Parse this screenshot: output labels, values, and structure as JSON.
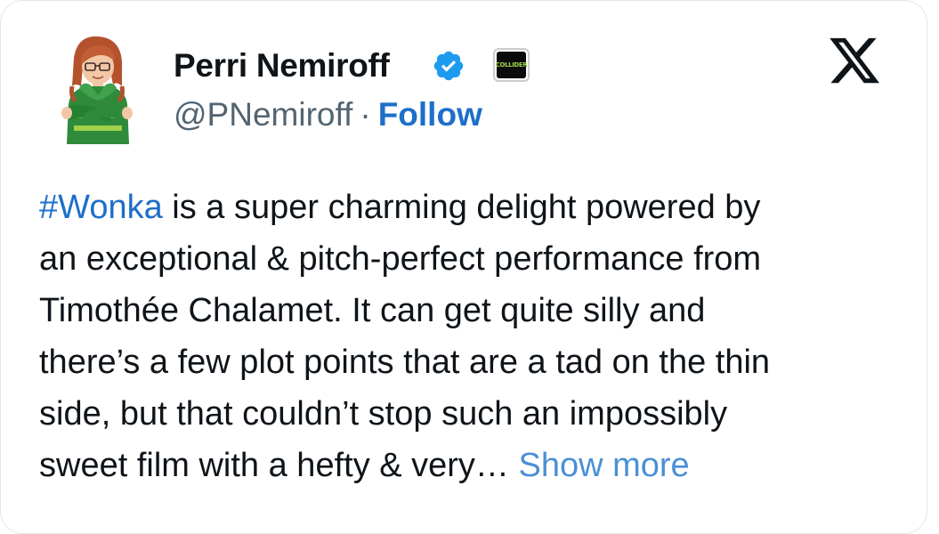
{
  "author": {
    "display_name": "Perri Nemiroff",
    "handle": "@PNemiroff",
    "separator": "·",
    "follow_label": "Follow",
    "verified": true,
    "affiliate_badge_text": "COLLIDER"
  },
  "platform": {
    "logo_icon": "x-logo-icon"
  },
  "tweet": {
    "hashtag": "#Wonka",
    "line1_rest": " is a super charming delight powered by",
    "line2": "an exceptional & pitch-perfect performance from",
    "line3": "Timothée Chalamet. It can get quite silly and",
    "line4": "there’s a few plot points that are a tad on the thin",
    "line5": "side, but that couldn’t stop such an impossibly",
    "line6": "sweet film with a hefty & very… ",
    "show_more_label": "Show more"
  },
  "colors": {
    "link": "#1d6fc9",
    "show_more": "#4a90d4",
    "verified_badge": "#1d9bf0",
    "text": "#0f1419",
    "secondary_text": "#536471"
  }
}
